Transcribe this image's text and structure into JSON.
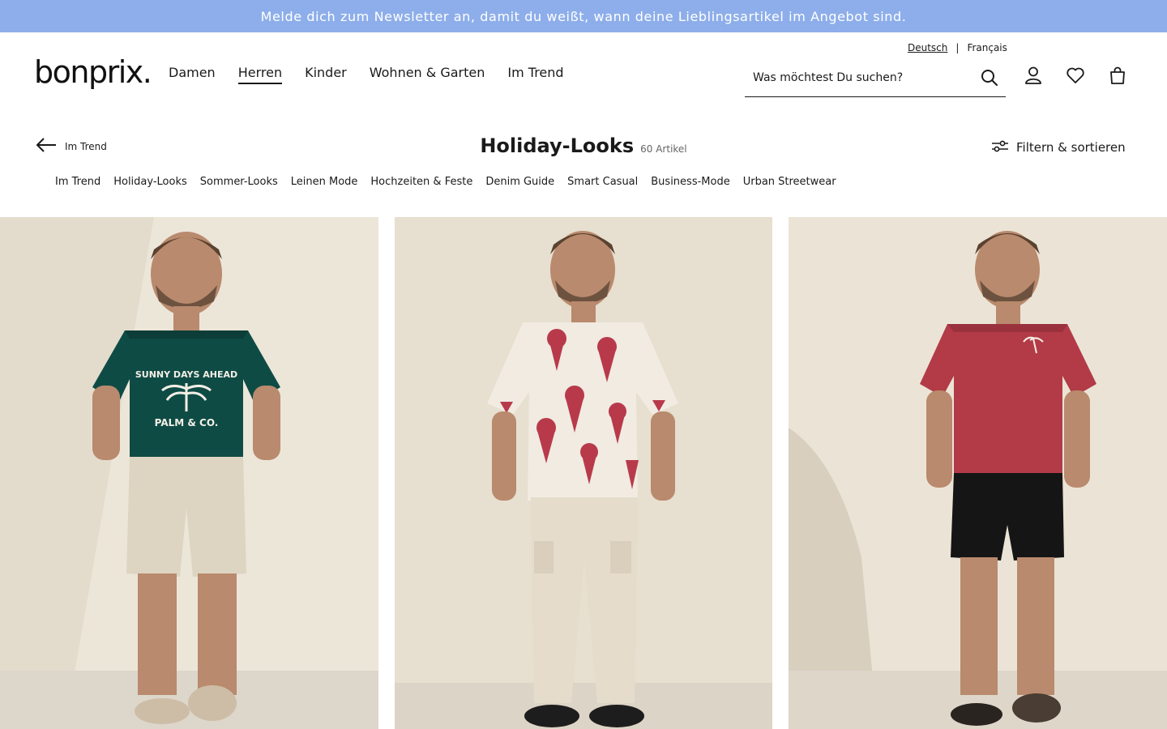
{
  "banner": {
    "text": "Melde dich zum Newsletter an, damit du weißt, wann deine Lieblingsartikel im Angebot sind."
  },
  "language": {
    "active": "Deutsch",
    "separator": "|",
    "other": "Français"
  },
  "brand": {
    "name": "bonprix."
  },
  "nav": {
    "items": [
      {
        "label": "Damen"
      },
      {
        "label": "Herren"
      },
      {
        "label": "Kinder"
      },
      {
        "label": "Wohnen & Garten"
      },
      {
        "label": "Im Trend"
      }
    ],
    "active": "Herren"
  },
  "search": {
    "placeholder": "Was möchtest Du suchen?"
  },
  "header_icons": [
    "search-icon",
    "account-icon",
    "wishlist-heart-icon",
    "shopping-bag-icon"
  ],
  "category": {
    "back_label": "Im Trend",
    "title": "Holiday-Looks",
    "count": "60 Artikel",
    "filter_label": "Filtern & sortieren"
  },
  "subnav": [
    {
      "label": "Im Trend"
    },
    {
      "label": "Holiday-Looks"
    },
    {
      "label": "Sommer-Looks"
    },
    {
      "label": "Leinen Mode"
    },
    {
      "label": "Hochzeiten & Feste"
    },
    {
      "label": "Denim Guide"
    },
    {
      "label": "Smart Casual"
    },
    {
      "label": "Business-Mode"
    },
    {
      "label": "Urban Streetwear"
    }
  ],
  "products": [
    {
      "shirt_text_1": "SUNNY DAYS AHEAD",
      "shirt_text_2": "PALM & CO.",
      "shirt_color": "#0f4b45",
      "bottom_color": "#ddd5c2"
    },
    {
      "shirt_color": "#f1ebe2",
      "pattern_color": "#b83a4a",
      "bottom_color": "#e5dccb"
    },
    {
      "shirt_color": "#b23b47",
      "bottom_color": "#151515"
    }
  ],
  "colors": {
    "banner": "#8daeea",
    "text": "#1a1a1a",
    "photo_bg": "#ebe4d6"
  }
}
